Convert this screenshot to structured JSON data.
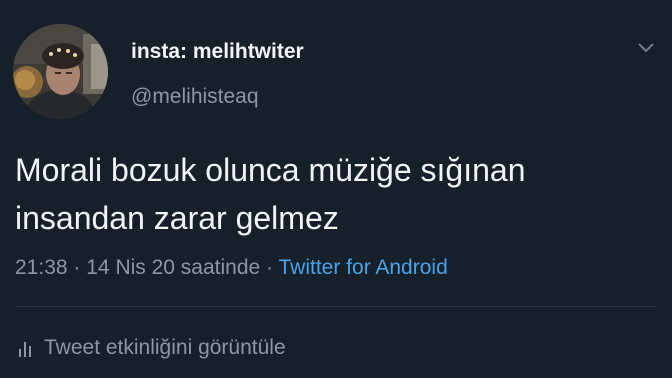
{
  "tweet": {
    "display_name": "insta: melihtwiter",
    "handle": "@melihisteaq",
    "text": "Morali bozuk olunca müziğe sığınan insandan zarar gelmez",
    "time": "21:38",
    "date": "14 Nis 20 saatinde",
    "separator": "·",
    "source": "Twitter for Android",
    "activity_label": "Tweet etkinliğini görüntüle"
  },
  "icons": {
    "more": "chevron-down-icon",
    "activity": "bar-chart-icon",
    "avatar": "profile-photo"
  },
  "colors": {
    "background": "#16202b",
    "primary_text": "#f1f4f6",
    "secondary_text": "#8a98a5",
    "link": "#4aa3e8",
    "divider": "#2a3846"
  }
}
